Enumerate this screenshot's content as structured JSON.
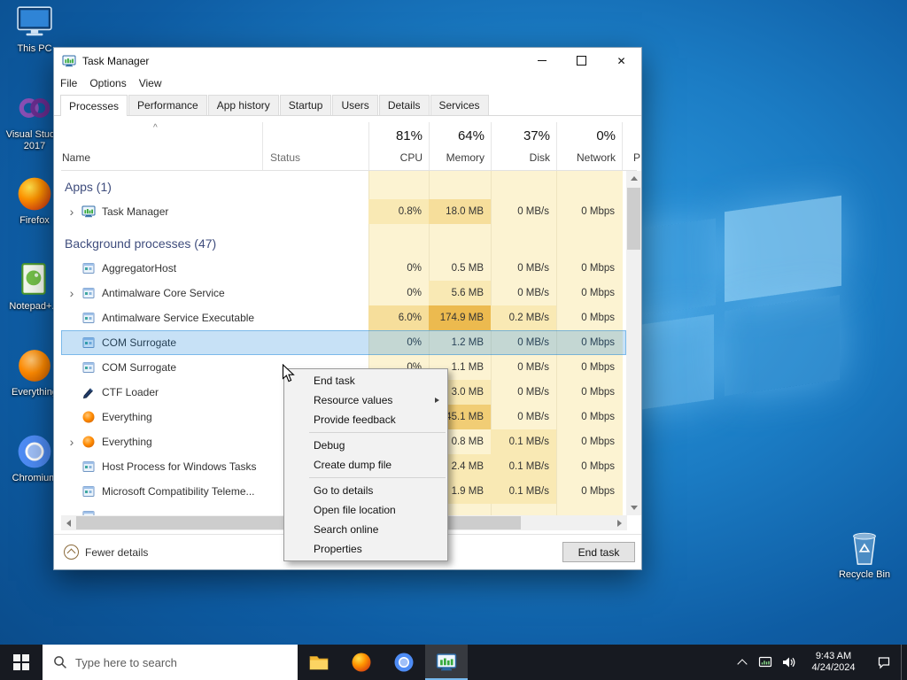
{
  "desktop": {
    "icons": [
      {
        "id": "this-pc",
        "icon": "this-pc",
        "label": "This PC"
      },
      {
        "id": "visual-studio-2017",
        "icon": "visual-studio",
        "label": "Visual Stud...\n2017"
      },
      {
        "id": "firefox",
        "icon": "firefox",
        "label": "Firefox"
      },
      {
        "id": "notepad-plus-plus",
        "icon": "notepad",
        "label": "Notepad+..."
      },
      {
        "id": "everything",
        "icon": "everything",
        "label": "Everything"
      },
      {
        "id": "chromium",
        "icon": "chromium",
        "label": "Chromium"
      }
    ],
    "recycle_bin": {
      "label": "Recycle Bin"
    }
  },
  "window": {
    "title": "Task Manager",
    "menu_items": [
      "File",
      "Options",
      "View"
    ],
    "tabs": [
      {
        "label": "Processes",
        "active": true
      },
      {
        "label": "Performance",
        "active": false
      },
      {
        "label": "App history",
        "active": false
      },
      {
        "label": "Startup",
        "active": false
      },
      {
        "label": "Users",
        "active": false
      },
      {
        "label": "Details",
        "active": false
      },
      {
        "label": "Services",
        "active": false
      }
    ],
    "header": {
      "name": "Name",
      "status": "Status",
      "cpu": {
        "pct": "81%",
        "label": "CPU"
      },
      "memory": {
        "pct": "64%",
        "label": "Memory"
      },
      "disk": {
        "pct": "37%",
        "label": "Disk"
      },
      "network": {
        "pct": "0%",
        "label": "Network"
      },
      "next_column_partial": "P"
    },
    "groups": [
      {
        "header": "Apps (1)",
        "rows": [
          {
            "name": "Task Manager",
            "icon": "taskmgr",
            "expandable": true,
            "selected": false,
            "status": "",
            "cpu": "0.8%",
            "memory": "18.0 MB",
            "disk": "0 MB/s",
            "network": "0 Mbps",
            "heat": {
              "cpu": 1,
              "memory": 2,
              "disk": 0,
              "network": 0
            }
          }
        ]
      },
      {
        "header": "Background processes (47)",
        "rows": [
          {
            "name": "AggregatorHost",
            "icon": "generic",
            "expandable": false,
            "selected": false,
            "status": "",
            "cpu": "0%",
            "memory": "0.5 MB",
            "disk": "0 MB/s",
            "network": "0 Mbps",
            "heat": {
              "cpu": 0,
              "memory": 0,
              "disk": 0,
              "network": 0
            }
          },
          {
            "name": "Antimalware Core Service",
            "icon": "generic",
            "expandable": true,
            "selected": false,
            "status": "",
            "cpu": "0%",
            "memory": "5.6 MB",
            "disk": "0 MB/s",
            "network": "0 Mbps",
            "heat": {
              "cpu": 0,
              "memory": 1,
              "disk": 0,
              "network": 0
            }
          },
          {
            "name": "Antimalware Service Executable",
            "icon": "generic",
            "expandable": false,
            "selected": false,
            "status": "",
            "cpu": "6.0%",
            "memory": "174.9 MB",
            "disk": "0.2 MB/s",
            "network": "0 Mbps",
            "heat": {
              "cpu": 2,
              "memory": 4,
              "disk": 1,
              "network": 0
            }
          },
          {
            "name": "COM Surrogate",
            "icon": "generic",
            "expandable": false,
            "selected": true,
            "status": "",
            "cpu": "0%",
            "memory": "1.2 MB",
            "disk": "0 MB/s",
            "network": "0 Mbps",
            "heat": {
              "cpu": 0,
              "memory": 0,
              "disk": 0,
              "network": 0
            }
          },
          {
            "name": "COM Surrogate",
            "icon": "generic",
            "expandable": false,
            "selected": false,
            "status": "",
            "cpu": "0%",
            "memory": "1.1 MB",
            "disk": "0 MB/s",
            "network": "0 Mbps",
            "heat": {
              "cpu": 0,
              "memory": 0,
              "disk": 0,
              "network": 0
            }
          },
          {
            "name": "CTF Loader",
            "icon": "ctf",
            "expandable": false,
            "selected": false,
            "status": "",
            "cpu": "",
            "memory": "3.0 MB",
            "disk": "0 MB/s",
            "network": "0 Mbps",
            "heat": {
              "cpu": 0,
              "memory": 1,
              "disk": 0,
              "network": 0
            }
          },
          {
            "name": "Everything",
            "icon": "everything-small",
            "expandable": false,
            "selected": false,
            "status": "",
            "cpu": "",
            "memory": "45.1 MB",
            "disk": "0 MB/s",
            "network": "0 Mbps",
            "heat": {
              "cpu": 0,
              "memory": 3,
              "disk": 0,
              "network": 0
            }
          },
          {
            "name": "Everything",
            "icon": "everything-small",
            "expandable": true,
            "selected": false,
            "status": "",
            "cpu": "",
            "memory": "0.8 MB",
            "disk": "0.1 MB/s",
            "network": "0 Mbps",
            "heat": {
              "cpu": 0,
              "memory": 0,
              "disk": 1,
              "network": 0
            }
          },
          {
            "name": "Host Process for Windows Tasks",
            "icon": "generic",
            "expandable": false,
            "selected": false,
            "status": "",
            "cpu": "",
            "memory": "2.4 MB",
            "disk": "0.1 MB/s",
            "network": "0 Mbps",
            "heat": {
              "cpu": 0,
              "memory": 1,
              "disk": 1,
              "network": 0
            }
          },
          {
            "name": "Microsoft Compatibility Teleme...",
            "icon": "generic",
            "expandable": false,
            "selected": false,
            "status": "",
            "cpu": "",
            "memory": "1.9 MB",
            "disk": "0.1 MB/s",
            "network": "0 Mbps",
            "heat": {
              "cpu": 0,
              "memory": 1,
              "disk": 1,
              "network": 0
            }
          }
        ]
      }
    ],
    "footer": {
      "fewer_details": "Fewer details",
      "end_task": "End task"
    }
  },
  "context_menu": {
    "items": [
      {
        "label": "End task",
        "submenu": false
      },
      {
        "label": "Resource values",
        "submenu": true
      },
      {
        "label": "Provide feedback",
        "submenu": false
      },
      {
        "separator": true
      },
      {
        "label": "Debug",
        "submenu": false
      },
      {
        "label": "Create dump file",
        "submenu": false
      },
      {
        "separator": true
      },
      {
        "label": "Go to details",
        "submenu": false
      },
      {
        "label": "Open file location",
        "submenu": false
      },
      {
        "label": "Search online",
        "submenu": false
      },
      {
        "label": "Properties",
        "submenu": false
      }
    ]
  },
  "taskbar": {
    "search_placeholder": "Type here to search",
    "app_icons": [
      {
        "id": "file-explorer",
        "icon": "folder",
        "active": false
      },
      {
        "id": "firefox",
        "icon": "firefox",
        "active": false
      },
      {
        "id": "chromium",
        "icon": "chromium",
        "active": false
      },
      {
        "id": "task-manager",
        "icon": "taskmgr",
        "active": true
      }
    ],
    "tray": {
      "time": "9:43 AM",
      "date": "4/24/2024"
    }
  },
  "colors": {
    "accent": "#0078d7",
    "selection_overlay": "rgba(0,120,215,0.22)",
    "heat_scale": [
      "#fcf3d2",
      "#f9e9b4",
      "#f6de9b",
      "#f1cd75",
      "#ecba4f"
    ]
  }
}
